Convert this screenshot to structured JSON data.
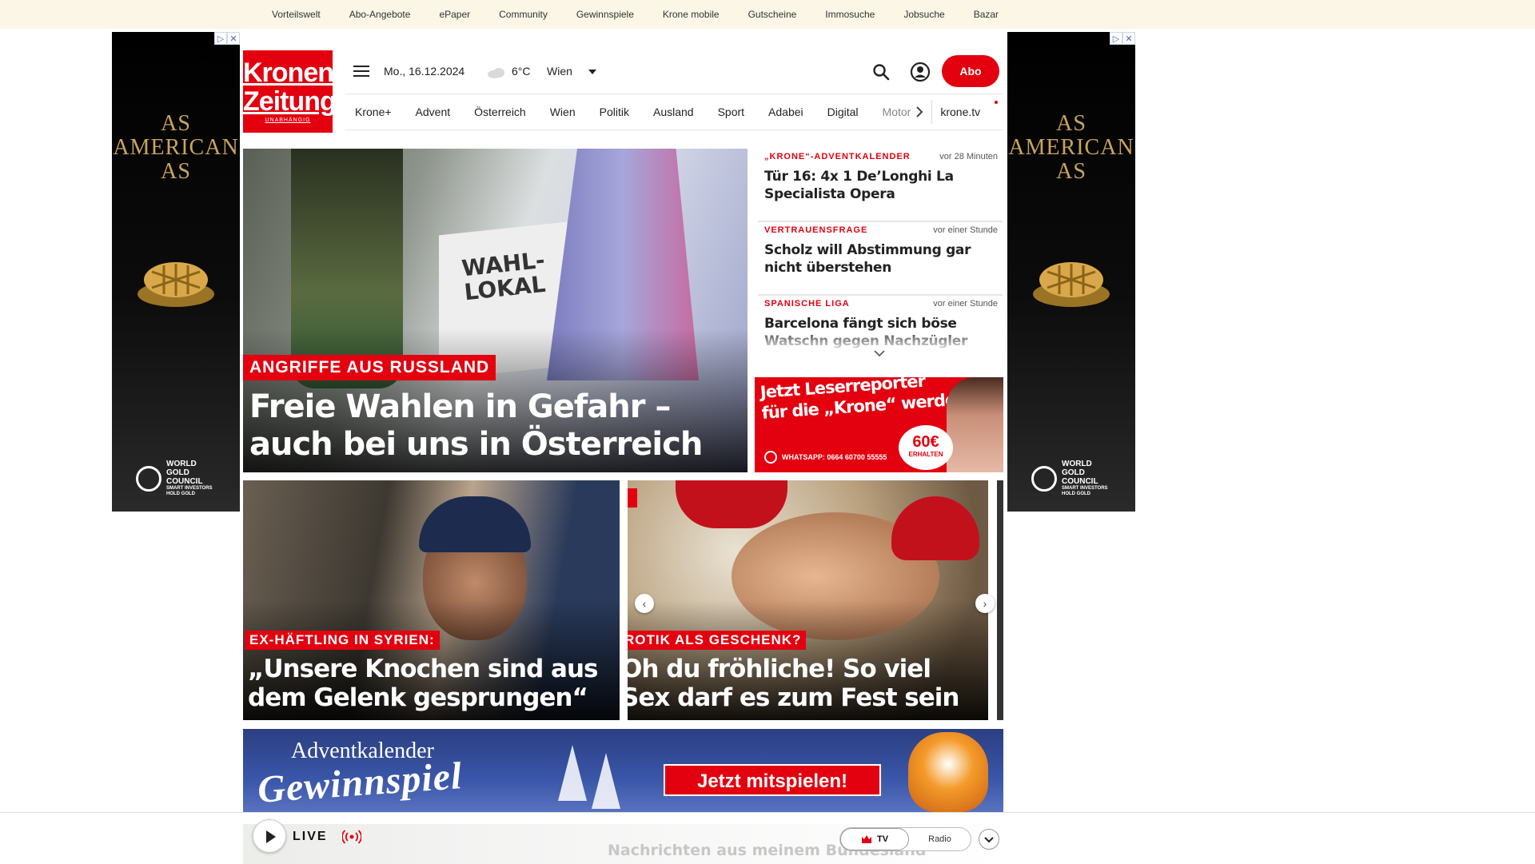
{
  "topnav": [
    "Vorteilswelt",
    "Abo-Angebote",
    "ePaper",
    "Community",
    "Gewinnspiele",
    "Krone mobile",
    "Gutscheine",
    "Immosuche",
    "Jobsuche",
    "Bazar"
  ],
  "side_ad": {
    "slogan_lines": [
      "AS",
      "AMERICAN",
      "AS"
    ],
    "brand_lines": [
      "WORLD",
      "GOLD",
      "COUNCIL"
    ],
    "brand_sub_lines": [
      "SMART INVESTORS",
      "HOLD GOLD"
    ]
  },
  "logo": {
    "line1": "Kronen",
    "line2": "Zeitung",
    "tagline": "UNABHÄNGIG"
  },
  "header": {
    "date": "Mo., 16.12.2024",
    "temperature": "6°C",
    "city": "Wien",
    "abo_label": "Abo"
  },
  "nav": {
    "items": [
      "Krone+",
      "Advent",
      "Österreich",
      "Wien",
      "Politik",
      "Ausland",
      "Sport",
      "Adabei",
      "Digital"
    ],
    "faded_item": "Motor",
    "tv_link": "krone.tv"
  },
  "hero": {
    "sign_text_line1": "WAHL-",
    "sign_text_line2": "LOKAL",
    "kicker": "ANGRIFFE AUS RUSSLAND",
    "title_line1": "Freie Wahlen in Gefahr –",
    "title_line2": "auch bei uns in Österreich"
  },
  "ticker": [
    {
      "category": "„KRONE“-ADVENTKALENDER",
      "time": "vor 28 Minuten",
      "title": "Tür 16: 4x 1 De’Longhi La Specialista Opera"
    },
    {
      "category": "VERTRAUENSFRAGE",
      "time": "vor einer Stunde",
      "title": "Scholz will Abstimmung gar nicht überstehen"
    },
    {
      "category": "SPANISCHE LIGA",
      "time": "vor einer Stunde",
      "title": "Barcelona fängt sich böse Watschn gegen Nachzügler"
    }
  ],
  "reporter_ad": {
    "line1": "Jetzt Leserreporter",
    "line2": "für die „Krone“ werden",
    "whatsapp": "WHATSAPP: 0664 60700 55555",
    "badge_value": "60€",
    "badge_sub": "ERHALTEN"
  },
  "cards": [
    {
      "kicker": "EX-HÄFTLING IN SYRIEN:",
      "title_line1": "„Unsere Knochen sind aus",
      "title_line2": "dem Gelenk gesprungen“"
    },
    {
      "kicker": "ROTIK ALS GESCHENK?",
      "title_line1": "Oh du fröhliche! So viel",
      "title_line2": "Sex darf es zum Fest sein"
    }
  ],
  "advent_banner": {
    "line1": "Adventkalender",
    "line2": "Gewinnspiel",
    "cta": "Jetzt mitspielen!"
  },
  "player": {
    "live_label": "LIVE",
    "bg_text": "Nachrichten aus meinem Bundesland",
    "tv_label": "TV",
    "radio_label": "Radio"
  },
  "colors": {
    "brand_red": "#e3000f",
    "topbar_bg": "#fbf6e6",
    "ad_gold": "#c9a45c"
  },
  "icons": [
    "hamburger-icon",
    "cloud-icon",
    "caret-down-icon",
    "search-icon",
    "account-icon",
    "chevron-right-icon",
    "chevron-down-icon",
    "whatsapp-icon",
    "play-icon",
    "broadcast-icon",
    "crown-icon",
    "ad-close-icon",
    "ad-choices-icon"
  ]
}
